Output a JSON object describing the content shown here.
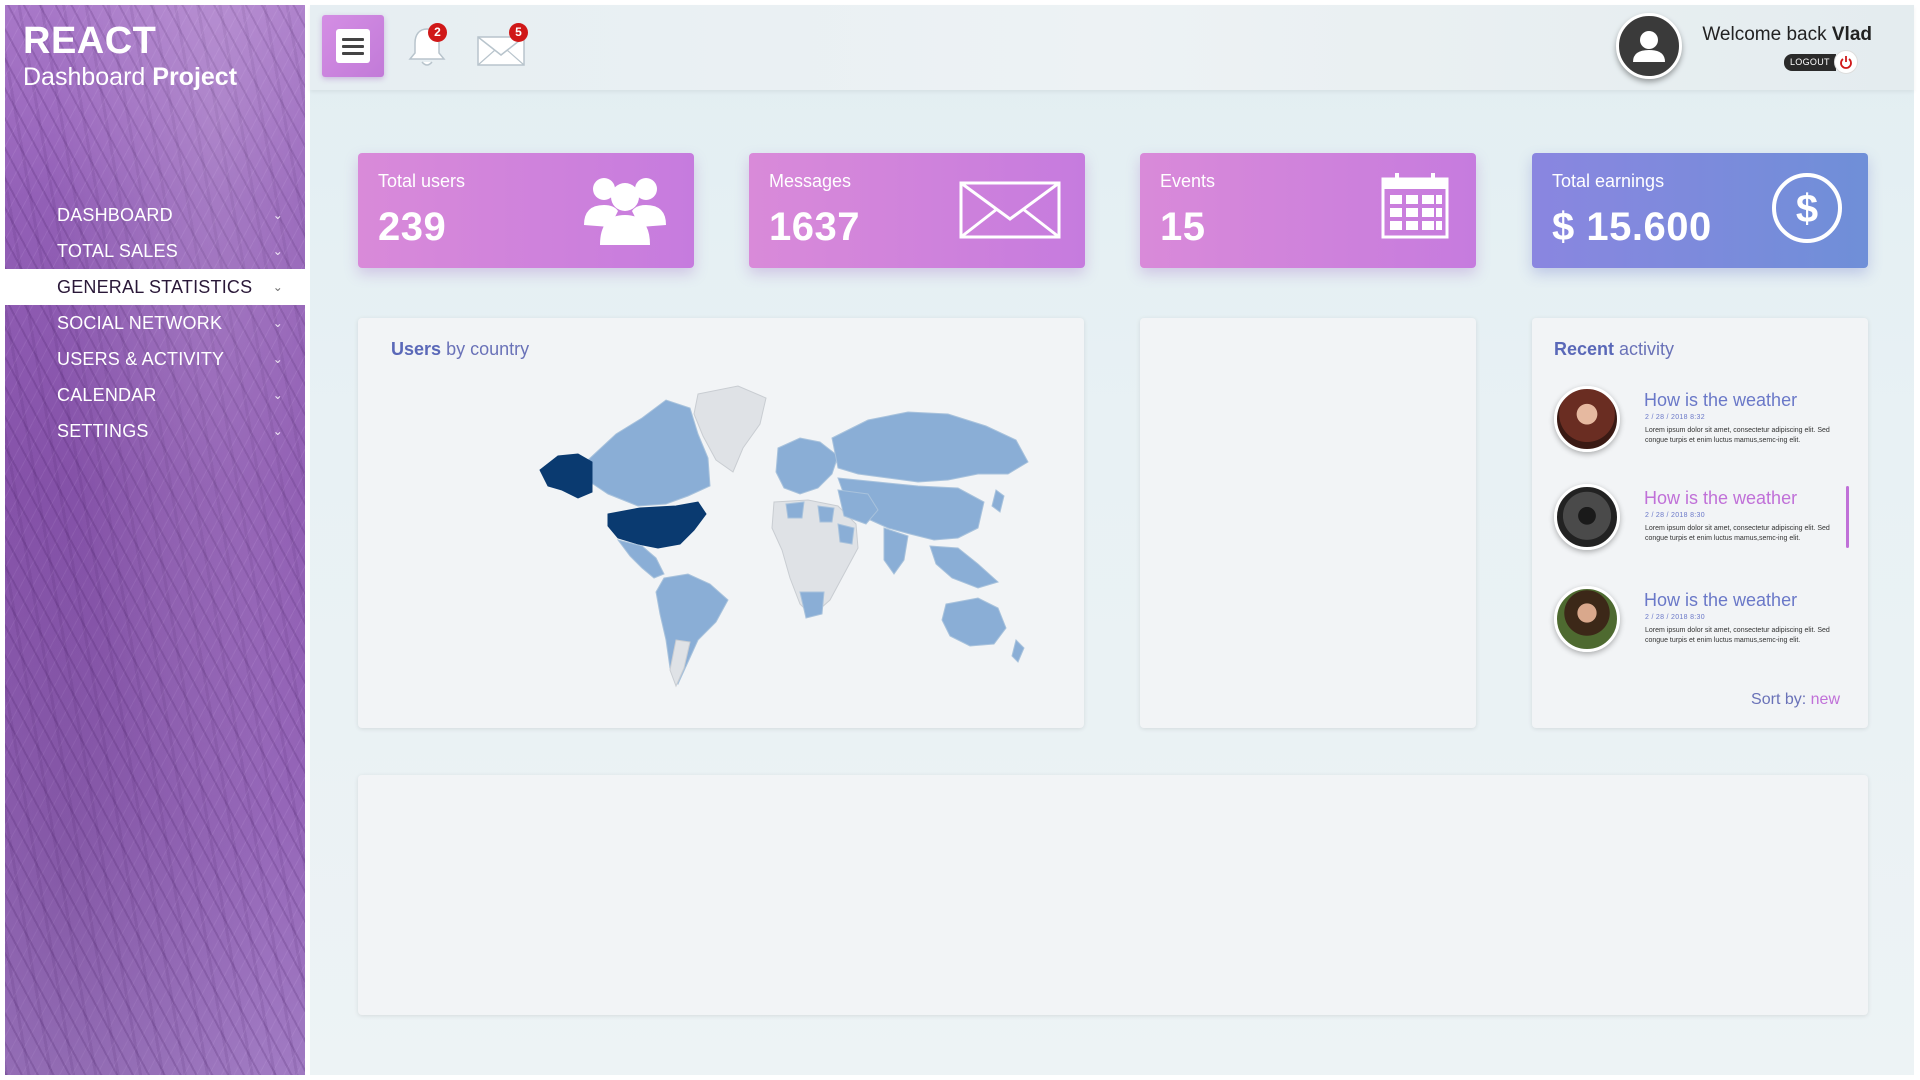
{
  "brand": {
    "title": "REACT",
    "subtitle_light": "Dashboard",
    "subtitle_bold": "Project"
  },
  "nav": {
    "items": [
      {
        "label": "DASHBOARD",
        "active": false
      },
      {
        "label": "TOTAL SALES",
        "active": false
      },
      {
        "label": "GENERAL STATISTICS",
        "active": true
      },
      {
        "label": "SOCIAL NETWORK",
        "active": false
      },
      {
        "label": "USERS & ACTIVITY",
        "active": false
      },
      {
        "label": "CALENDAR",
        "active": false
      },
      {
        "label": "SETTINGS",
        "active": false
      }
    ]
  },
  "topbar": {
    "notifications_count": "2",
    "messages_count": "5",
    "welcome_prefix": "Welcome back",
    "user_name": "Vlad",
    "logout_label": "LOGOUT"
  },
  "cards": {
    "users": {
      "label": "Total users",
      "value": "239"
    },
    "messages": {
      "label": "Messages",
      "value": "1637"
    },
    "events": {
      "label": "Events",
      "value": "15"
    },
    "earnings": {
      "label": "Total  earnings",
      "value": "$ 15.600"
    }
  },
  "map_panel": {
    "title_bold": "Users",
    "title_rest": "by country"
  },
  "activity": {
    "title_bold": "Recent",
    "title_rest": "activity",
    "items": [
      {
        "title": "How is the weather",
        "date": "2 / 28 / 2018   8:32",
        "text": "Lorem ipsum dolor sit amet, consectetur adipiscing elit. Sed congue turpis et enim luctus mamus,semc-ing elit."
      },
      {
        "title": "How is the weather",
        "date": "2 / 28 / 2018   8:30",
        "text": "Lorem ipsum dolor sit amet, consectetur adipiscing elit. Sed congue turpis et enim luctus mamus,semc-ing elit."
      },
      {
        "title": "How is the weather",
        "date": "2 / 28 / 2018   8:30",
        "text": "Lorem ipsum dolor sit amet, consectetur adipiscing elit. Sed congue turpis et enim luctus mamus,semc-ing elit."
      }
    ],
    "sort_label": "Sort by:",
    "sort_value": "new"
  },
  "colors": {
    "accent_pink": "#c67bde",
    "accent_blue": "#6f8fd8",
    "map_dark": "#0a3a70",
    "map_mid": "#8aaed6",
    "map_light": "#dfe2e6",
    "badge_red": "#d01818"
  },
  "icons": {
    "menu": "hamburger-menu-icon",
    "bell": "bell-icon",
    "mail": "envelope-icon",
    "users": "users-group-icon",
    "events": "calendar-icon",
    "earnings": "dollar-circle-icon",
    "power": "power-icon"
  }
}
